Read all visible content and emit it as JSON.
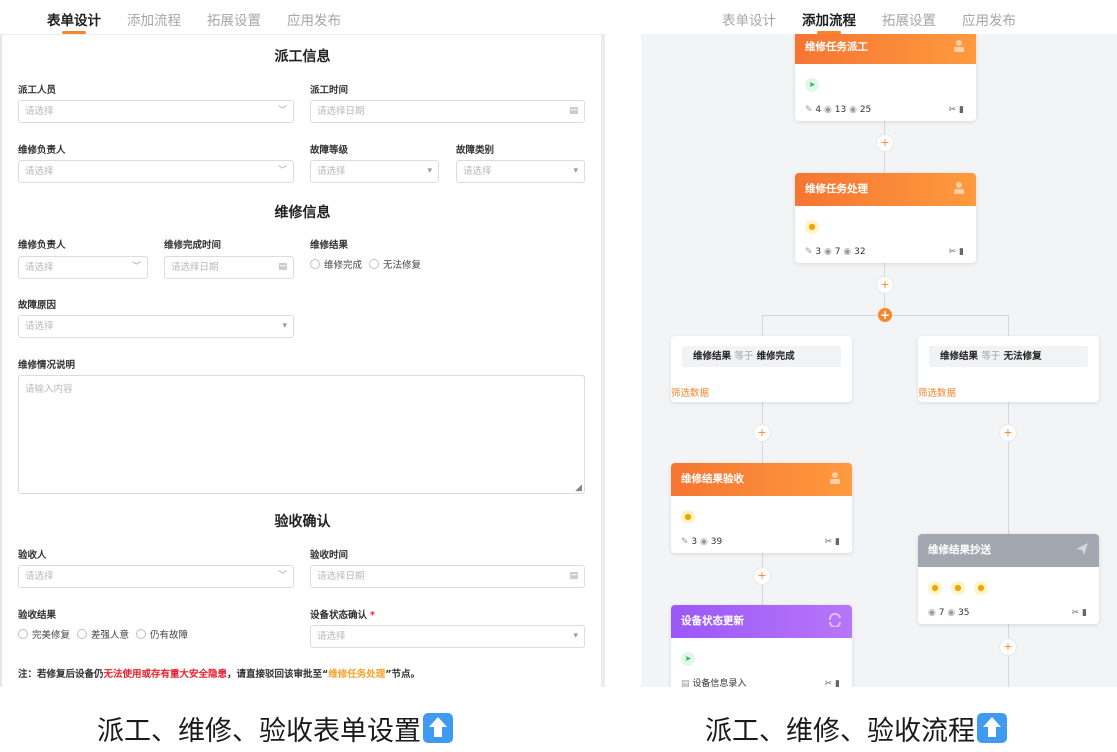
{
  "left_tabs": [
    "表单设计",
    "添加流程",
    "拓展设置",
    "应用发布"
  ],
  "right_tabs": [
    "表单设计",
    "添加流程",
    "拓展设置",
    "应用发布"
  ],
  "form": {
    "sec1": "派工信息",
    "sec2": "维修信息",
    "sec3": "验收确认",
    "f_dispatcher": {
      "label": "派工人员",
      "placeholder": "请选择"
    },
    "f_dispatch_time": {
      "label": "派工时间",
      "placeholder": "请选择日期"
    },
    "f_repair_owner1": {
      "label": "维修负责人",
      "placeholder": "请选择"
    },
    "f_fault_level": {
      "label": "故障等级",
      "placeholder": "请选择"
    },
    "f_fault_type": {
      "label": "故障类别",
      "placeholder": "请选择"
    },
    "f_repair_owner2": {
      "label": "维修负责人",
      "placeholder": "请选择"
    },
    "f_repair_done_time": {
      "label": "维修完成时间",
      "placeholder": "请选择日期"
    },
    "f_repair_result": {
      "label": "维修结果",
      "options": [
        "维修完成",
        "无法修复"
      ]
    },
    "f_fault_reason": {
      "label": "故障原因",
      "placeholder": "请选择"
    },
    "f_repair_desc": {
      "label": "维修情况说明",
      "placeholder": "请输入内容"
    },
    "f_acceptor": {
      "label": "验收人",
      "placeholder": "请选择"
    },
    "f_accept_time": {
      "label": "验收时间",
      "placeholder": "请选择日期"
    },
    "f_accept_result": {
      "label": "验收结果",
      "options": [
        "完美修复",
        "差强人意",
        "仍有故障"
      ]
    },
    "f_device_status": {
      "label": "设备状态确认",
      "required": "*",
      "placeholder": "请选择"
    },
    "note": {
      "p1": "注：若修复后设备仍",
      "p2": "无法使用或存有重大安全隐患",
      "p3": "，请直接驳回该审批至“",
      "p4": "维修任务处理",
      "p5": "”节点。"
    }
  },
  "flow": {
    "n1": {
      "title": "维修任务派工",
      "s1": "4",
      "s2": "13",
      "s3": "25"
    },
    "n2": {
      "title": "维修任务处理",
      "s1": "3",
      "s2": "7",
      "s3": "32"
    },
    "c1": {
      "field": "维修结果",
      "op": "等于",
      "value": "维修完成",
      "filter": "筛选数据"
    },
    "c2": {
      "field": "维修结果",
      "op": "等于",
      "value": "无法修复",
      "filter": "筛选数据"
    },
    "n3": {
      "title": "维修结果验收",
      "s1": "3",
      "s2": "39"
    },
    "n4": {
      "title": "维修结果抄送",
      "s1": "7",
      "s2": "35"
    },
    "n5": {
      "title": "设备状态更新",
      "item": "设备信息录入"
    }
  },
  "captions": {
    "left": "派工、维修、验收表单设置",
    "right": "派工、维修、验收流程"
  },
  "colors": {
    "accent": "#f5862a",
    "orange_header": "#f57532",
    "gray_header": "#a3a7b0",
    "purple_header": "#9b58f8",
    "warning_red": "#e8202e"
  }
}
